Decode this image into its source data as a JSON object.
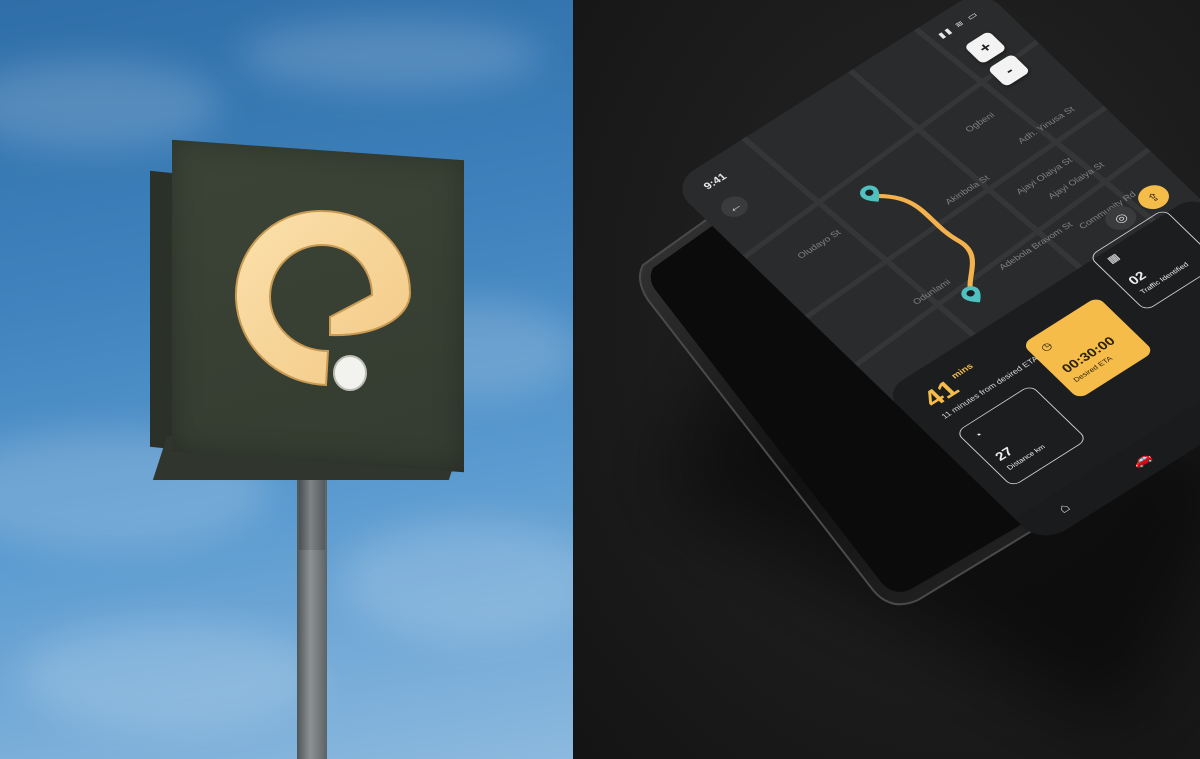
{
  "colors": {
    "sky": "#3f82bd",
    "sign_face": "#3c4437",
    "logo_cream": "#f9d9a0",
    "accent_yellow": "#f5bc4a",
    "marker_teal": "#4fc1c0",
    "route_orange": "#f4b24d",
    "phone_bg": "#1e1f20"
  },
  "status_bar": {
    "time": "9:41",
    "icons": "▮▮ ≋ ▭"
  },
  "map": {
    "zoom_in_label": "+",
    "zoom_out_label": "-",
    "back_label": "←",
    "streets": [
      "Oludayo St",
      "Odunlami",
      "Adebola Bravom St",
      "Akinbola St",
      "Ajayi Olaiya St",
      "Ajayi Olaiya St",
      "Community Rd",
      "Ogbeni",
      "Adh. Yinusa St"
    ]
  },
  "eta": {
    "value": "41",
    "unit": "mins",
    "description": "11 minutes from desired ETA"
  },
  "cards": [
    {
      "icon": "gauge-icon",
      "glyph": "◔",
      "value": "27",
      "label": "Distance km"
    },
    {
      "icon": "timer-icon",
      "glyph": "◷",
      "value": "00:30:00",
      "label": "Desired ETA"
    },
    {
      "icon": "calendar-icon",
      "glyph": "▦",
      "value": "02",
      "label": "Traffic Identified"
    }
  ],
  "side_icons": {
    "bell": "🔔",
    "gear": "⚙"
  },
  "nav": {
    "home": "⌂",
    "car": "🚗"
  }
}
